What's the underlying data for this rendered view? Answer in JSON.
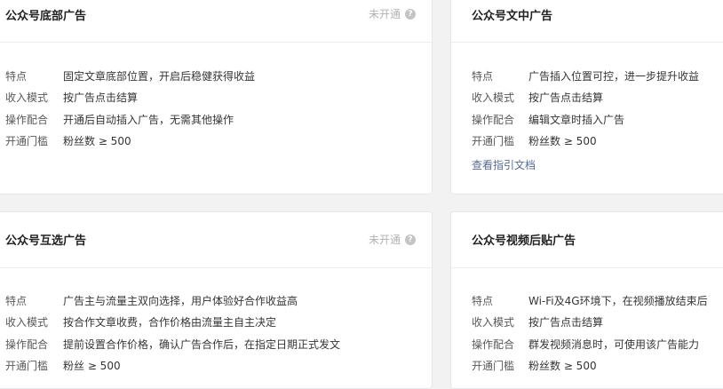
{
  "cards": [
    {
      "title": "公众号底部广告",
      "status": "未开通",
      "rows": [
        {
          "label": "特点",
          "value": "固定文章底部位置，开启后稳健获得收益"
        },
        {
          "label": "收入模式",
          "value": "按广告点击结算"
        },
        {
          "label": "操作配合",
          "value": "开通后自动插入广告，无需其他操作"
        },
        {
          "label": "开通门槛",
          "value": "粉丝数 ≥ 500"
        }
      ]
    },
    {
      "title": "公众号文中广告",
      "rows": [
        {
          "label": "特点",
          "value": "广告插入位置可控，进一步提升收益"
        },
        {
          "label": "收入模式",
          "value": "按广告点击结算"
        },
        {
          "label": "操作配合",
          "value": "编辑文章时插入广告"
        },
        {
          "label": "开通门槛",
          "value": "粉丝数 ≥ 500"
        }
      ],
      "link": "查看指引文档"
    },
    {
      "title": "公众号互选广告",
      "status": "未开通",
      "rows": [
        {
          "label": "特点",
          "value": "广告主与流量主双向选择，用户体验好合作收益高"
        },
        {
          "label": "收入模式",
          "value": "按合作文章收费，合作价格由流量主自主决定"
        },
        {
          "label": "操作配合",
          "value": "提前设置合作价格，确认广告合作后，在指定日期正式发文"
        },
        {
          "label": "开通门槛",
          "value": "粉丝 ≥ 500"
        }
      ]
    },
    {
      "title": "公众号视频后贴广告",
      "rows": [
        {
          "label": "特点",
          "value": "Wi-Fi及4G环境下，在视频播放结束后"
        },
        {
          "label": "收入模式",
          "value": "按广告点击结算"
        },
        {
          "label": "操作配合",
          "value": "群发视频消息时，可使用该广告能力"
        },
        {
          "label": "开通门槛",
          "value": "粉丝数 ≥ 500"
        }
      ]
    }
  ],
  "colors": {
    "background": "#f2f2f2",
    "card": "#ffffff",
    "link": "#576b95",
    "status": "#b2b2b2"
  },
  "icons": {
    "status_help": "question-circle-icon"
  }
}
